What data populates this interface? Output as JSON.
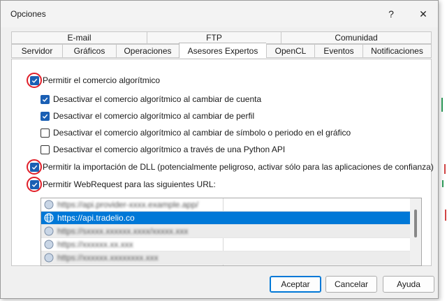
{
  "window": {
    "title": "Opciones",
    "help_glyph": "?",
    "close_glyph": "✕"
  },
  "tabs": {
    "row1": [
      "E-mail",
      "FTP",
      "Comunidad"
    ],
    "row2": [
      "Servidor",
      "Gráficos",
      "Operaciones",
      "Asesores Expertos",
      "OpenCL",
      "Eventos",
      "Notificaciones"
    ],
    "active": "Asesores Expertos"
  },
  "options": [
    {
      "label": "Permitir el comercio algorítmico",
      "checked": true,
      "highlighted": true
    },
    {
      "label": "Desactivar el comercio algorítmico al cambiar de cuenta",
      "checked": true,
      "highlighted": false
    },
    {
      "label": "Desactivar el comercio algorítmico al cambiar de perfil",
      "checked": true,
      "highlighted": false
    },
    {
      "label": "Desactivar el comercio algorítmico al cambiar de símbolo o periodo en el gráfico",
      "checked": false,
      "highlighted": false
    },
    {
      "label": "Desactivar el comercio algorítmico a través de una Python API",
      "checked": false,
      "highlighted": false
    },
    {
      "label": "Permitir la importación de DLL (potencialmente peligroso, activar sólo para las aplicaciones de confianza)",
      "checked": true,
      "highlighted": true
    },
    {
      "label": "Permitir WebRequest para las siguientes URL:",
      "checked": true,
      "highlighted": true
    }
  ],
  "url_list": [
    {
      "text": "https://api.provider-xxxx.example.app/",
      "obscured": true,
      "selected": false
    },
    {
      "text": "https://api.tradelio.co",
      "obscured": false,
      "selected": true
    },
    {
      "text": "https://sxxxx.xxxxxx.xxxx/xxxxx.xxx",
      "obscured": true,
      "selected": false
    },
    {
      "text": "https://xxxxxx.xx.xxx",
      "obscured": true,
      "selected": false
    },
    {
      "text": "https://xxxxxx.xxxxxxxx.xxx",
      "obscured": true,
      "selected": false
    }
  ],
  "buttons": {
    "accept": "Aceptar",
    "cancel": "Cancelar",
    "help": "Ayuda"
  },
  "colors": {
    "accent": "#1a5fb4",
    "selection": "#0078d7",
    "highlight_circle": "#e0202a"
  }
}
